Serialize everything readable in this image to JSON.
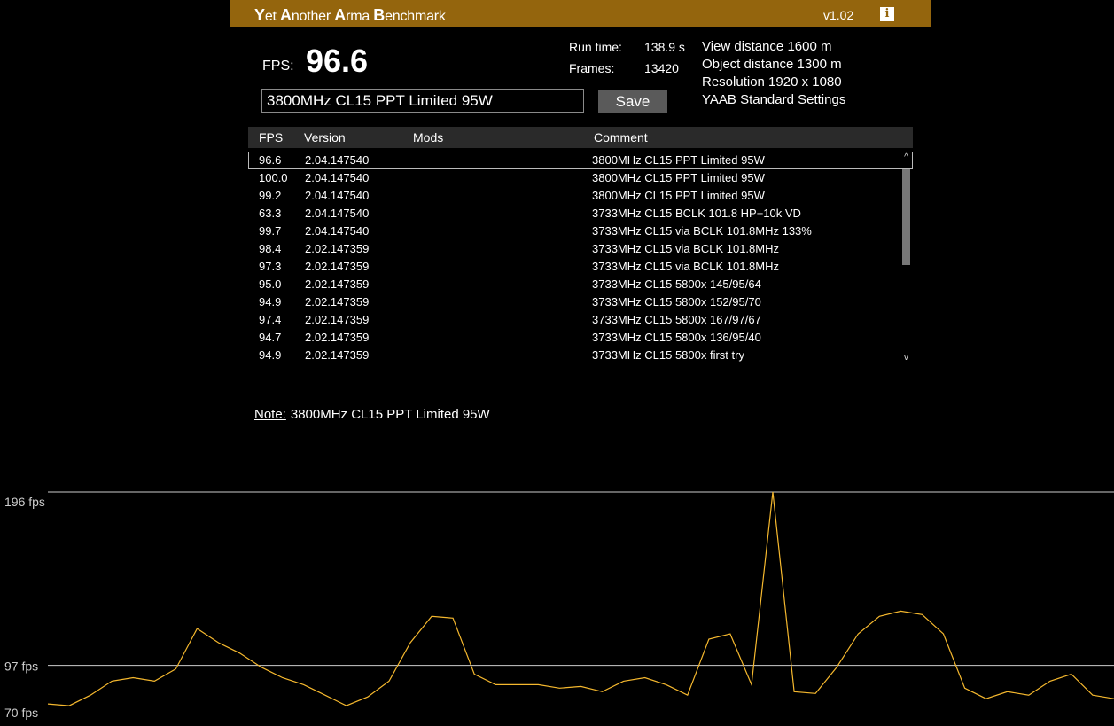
{
  "app": {
    "title_parts": [
      {
        "cap": "Y",
        "rest": "et "
      },
      {
        "cap": "A",
        "rest": "nother "
      },
      {
        "cap": "A",
        "rest": "rma "
      },
      {
        "cap": "B",
        "rest": "enchmark"
      }
    ],
    "version": "v1.02",
    "info_icon": "i"
  },
  "result": {
    "fps_label": "FPS:",
    "fps_value": "96.6",
    "run_time_label": "Run time:",
    "run_time_value": "138.9 s",
    "frames_label": "Frames:",
    "frames_value": "13420"
  },
  "settings": [
    "View distance 1600 m",
    "Object distance 1300 m",
    "Resolution 1920 x 1080",
    "YAAB Standard Settings"
  ],
  "comment": {
    "value": "3800MHz CL15 PPT Limited 95W",
    "save_label": "Save"
  },
  "table": {
    "headers": {
      "fps": "FPS",
      "version": "Version",
      "mods": "Mods",
      "comment": "Comment"
    },
    "rows": [
      {
        "fps": "96.6",
        "version": "2.04.147540",
        "mods": "",
        "comment": "3800MHz CL15 PPT Limited 95W"
      },
      {
        "fps": "100.0",
        "version": "2.04.147540",
        "mods": "",
        "comment": "3800MHz CL15 PPT Limited 95W"
      },
      {
        "fps": "99.2",
        "version": "2.04.147540",
        "mods": "",
        "comment": "3800MHz CL15 PPT Limited 95W"
      },
      {
        "fps": "63.3",
        "version": "2.04.147540",
        "mods": "",
        "comment": "3733MHz CL15 BCLK 101.8 HP+10k VD"
      },
      {
        "fps": "99.7",
        "version": "2.04.147540",
        "mods": "",
        "comment": "3733MHz CL15 via BCLK 101.8MHz 133%"
      },
      {
        "fps": "98.4",
        "version": "2.02.147359",
        "mods": "",
        "comment": "3733MHz CL15 via BCLK 101.8MHz"
      },
      {
        "fps": "97.3",
        "version": "2.02.147359",
        "mods": "",
        "comment": "3733MHz CL15 via BCLK 101.8MHz"
      },
      {
        "fps": "95.0",
        "version": "2.02.147359",
        "mods": "",
        "comment": "3733MHz CL15 5800x 145/95/64"
      },
      {
        "fps": "94.9",
        "version": "2.02.147359",
        "mods": "",
        "comment": "3733MHz CL15 5800x 152/95/70"
      },
      {
        "fps": "97.4",
        "version": "2.02.147359",
        "mods": "",
        "comment": "3733MHz CL15 5800x 167/97/67"
      },
      {
        "fps": "94.7",
        "version": "2.02.147359",
        "mods": "",
        "comment": "3733MHz CL15 5800x 136/95/40"
      },
      {
        "fps": "94.9",
        "version": "2.02.147359",
        "mods": "",
        "comment": "3733MHz CL15 5800x first try"
      }
    ],
    "scroll_up": "^",
    "scroll_down": "v"
  },
  "note": {
    "label": "Note:",
    "text": "3800MHz CL15 PPT Limited 95W"
  },
  "colors": {
    "title_bar": "#94650d",
    "graph_line": "#f5b82e",
    "gridline": "#cccccc"
  },
  "chart_data": {
    "type": "line",
    "ylim": [
      70,
      196
    ],
    "y_ticks": [
      {
        "value": 196,
        "label": "196 fps"
      },
      {
        "value": 97,
        "label": "97 fps"
      },
      {
        "value": 70,
        "label": "70 fps"
      }
    ],
    "x": [
      0,
      2,
      4,
      6,
      8,
      10,
      12,
      14,
      16,
      18,
      20,
      22,
      24,
      26,
      28,
      30,
      32,
      34,
      36,
      38,
      40,
      42,
      44,
      46,
      48,
      50,
      52,
      54,
      56,
      58,
      60,
      62,
      64,
      66,
      68,
      70,
      72,
      74,
      76,
      78,
      80,
      82,
      84,
      86,
      88,
      90,
      92,
      94,
      96,
      98,
      100
    ],
    "values": [
      75,
      74,
      80,
      88,
      90,
      88,
      95,
      118,
      110,
      104,
      96,
      90,
      86,
      80,
      74,
      79,
      88,
      110,
      125,
      124,
      92,
      86,
      86,
      86,
      84,
      85,
      82,
      88,
      90,
      86,
      80,
      112,
      115,
      86,
      196,
      82,
      81,
      96,
      115,
      125,
      128,
      126,
      115,
      84,
      78,
      82,
      80,
      88,
      92,
      80,
      78
    ]
  }
}
